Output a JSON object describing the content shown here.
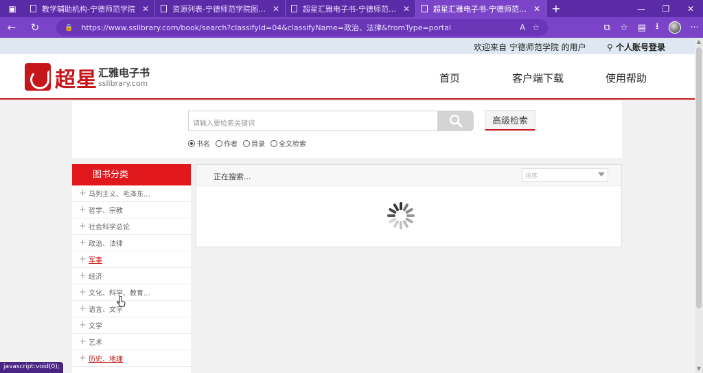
{
  "browser": {
    "tabs": [
      {
        "title": "教学辅助机构-宁德师范学院",
        "active": false
      },
      {
        "title": "资源列表-宁德师范学院图书馆",
        "active": false
      },
      {
        "title": "超星汇雅电子书-宁德师范学院",
        "active": false
      },
      {
        "title": "超星汇雅电子书-宁德师范学院",
        "active": true
      }
    ],
    "url": "https://www.sslibrary.com/book/search?classifyId=04&classifyName=政治、法律&fromType=portal"
  },
  "site": {
    "welcome": "欢迎来自 宁德师范学院 的用户",
    "login": "个人账号登录",
    "logo_cn": "超星",
    "logo_sub": "汇雅电子书",
    "logo_url": "sslibrary.com",
    "nav": [
      "首页",
      "客户端下载",
      "使用帮助"
    ]
  },
  "search": {
    "placeholder": "请输入要检索关键词",
    "advanced": "高级检索",
    "options": [
      {
        "label": "书名",
        "selected": true
      },
      {
        "label": "作者",
        "selected": false
      },
      {
        "label": "目录",
        "selected": false
      },
      {
        "label": "全文检索",
        "selected": false
      }
    ]
  },
  "sidebar": {
    "title": "图书分类",
    "categories": [
      {
        "label": "马列主义、毛泽东...",
        "link": false
      },
      {
        "label": "哲学、宗教",
        "link": false
      },
      {
        "label": "社会科学总论",
        "link": false
      },
      {
        "label": "政治、法律",
        "link": false
      },
      {
        "label": "军事",
        "link": true
      },
      {
        "label": "经济",
        "link": false
      },
      {
        "label": "文化、科学、教育...",
        "link": false
      },
      {
        "label": "语言、文字",
        "link": false
      },
      {
        "label": "文学",
        "link": false
      },
      {
        "label": "艺术",
        "link": false
      },
      {
        "label": "历史、地理",
        "link": true
      }
    ]
  },
  "results": {
    "status": "正在搜索...",
    "sort_placeholder": "排序"
  },
  "statusbar": "javascript:void(0);"
}
